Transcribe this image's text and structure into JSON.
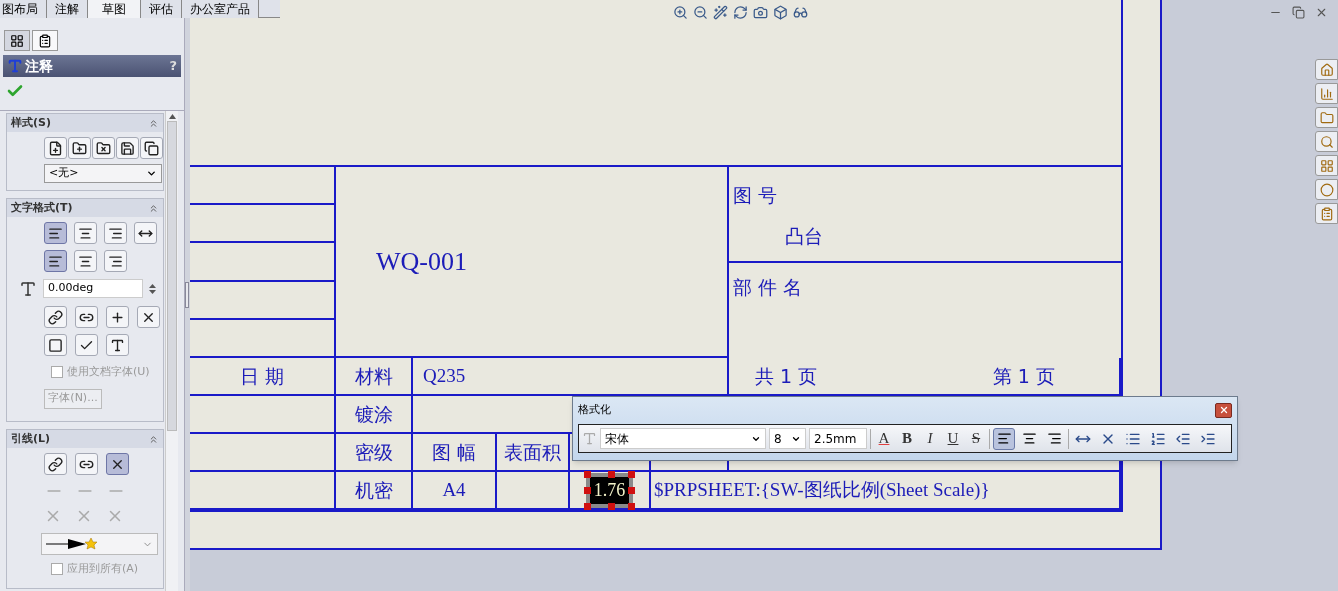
{
  "tabs": [
    {
      "label": "图布局",
      "selected": false
    },
    {
      "label": "注解",
      "selected": false
    },
    {
      "label": "草图",
      "selected": true
    },
    {
      "label": "评估",
      "selected": false
    },
    {
      "label": "办公室产品",
      "selected": false
    }
  ],
  "panel_tabs": [
    {
      "selected": false
    },
    {
      "selected": true
    }
  ],
  "property_manager": {
    "title": "注释",
    "help": "?"
  },
  "style_group": {
    "title": "样式(S)",
    "dropdown": "<无>"
  },
  "text_format_group": {
    "title": "文字格式(T)",
    "align": [
      {
        "selected": true
      },
      {
        "selected": false
      },
      {
        "selected": false
      },
      {
        "selected": false
      }
    ],
    "valign": [
      {
        "selected": true
      },
      {
        "selected": false
      },
      {
        "selected": false
      }
    ],
    "angle": "0.00deg",
    "use_doc_font": {
      "label": "使用文档字体(U)",
      "checked": false
    },
    "font_button": {
      "label": "字体(N)...",
      "disabled": true
    }
  },
  "leader_group": {
    "title": "引线(L)",
    "leader_buttons": [
      {
        "selected": false
      },
      {
        "selected": false
      },
      {
        "selected": true
      }
    ],
    "apply_all": {
      "label": "应用到所有(A)",
      "checked": false
    }
  },
  "title_block": {
    "drawing_no_label": "图 号",
    "part": "凸台",
    "part_name_label": "部 件 名",
    "drawing_no": "WQ-001",
    "date_label": "日 期",
    "material_label": "材料",
    "material": "Q235",
    "total_pages": "共 1 页",
    "page": "第 1 页",
    "coating_label": "镀涂",
    "secrecy_label": "密级",
    "size_label": "图 幅",
    "area_label": "表面积",
    "secrecy": "机密",
    "size": "A4",
    "note": {
      "text": "1.76",
      "selected": true
    },
    "scale": "$PRPSHEET:{SW-图纸比例(Sheet Scale)}"
  },
  "format_dialog": {
    "title": "格式化",
    "font": "宋体",
    "size": "8",
    "height": "2.5mm",
    "styles": [
      {
        "kind": "color",
        "label": "A"
      },
      {
        "kind": "bold",
        "label": "B"
      },
      {
        "kind": "italic",
        "label": "I"
      },
      {
        "kind": "underline",
        "label": "U"
      },
      {
        "kind": "strike",
        "label": "S"
      }
    ],
    "align": [
      {
        "selected": true
      },
      {
        "selected": false
      },
      {
        "selected": false
      }
    ]
  }
}
